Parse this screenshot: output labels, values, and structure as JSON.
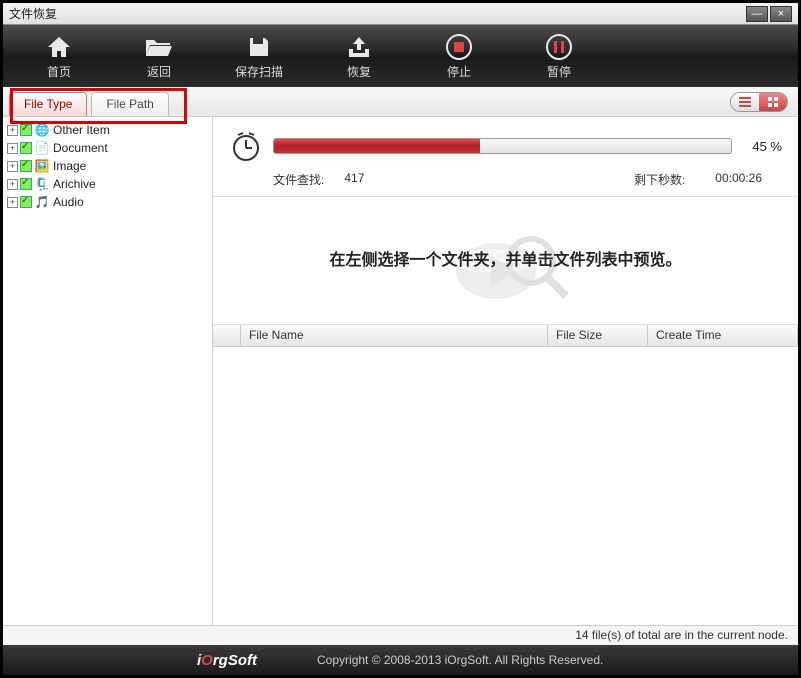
{
  "title": "文件恢复",
  "winbuttons": {
    "min": "—",
    "close": "×"
  },
  "toolbar": [
    {
      "label": "首页",
      "icon": "home"
    },
    {
      "label": "返回",
      "icon": "folder"
    },
    {
      "label": "保存扫描",
      "icon": "save"
    },
    {
      "label": "恢复",
      "icon": "recover"
    },
    {
      "label": "停止",
      "icon": "stop"
    },
    {
      "label": "暂停",
      "icon": "pause"
    }
  ],
  "tabs": {
    "type": "File Type",
    "path": "File Path"
  },
  "tree": [
    {
      "label": "Other Item",
      "icon": "globe"
    },
    {
      "label": "Document",
      "icon": "doc"
    },
    {
      "label": "Image",
      "icon": "img"
    },
    {
      "label": "Arichive",
      "icon": "zip"
    },
    {
      "label": "Audio",
      "icon": "audio"
    }
  ],
  "progress": {
    "percent_label": "45 %",
    "percent_value": 45,
    "scan_label": "文件查找:",
    "scan_value": "417",
    "remain_label": "剩下秒数:",
    "remain_value": "00:00:26"
  },
  "preview_hint": "在左侧选择一个文件夹，并单击文件列表中预览。",
  "columns": {
    "name": "File Name",
    "size": "File Size",
    "time": "Create Time"
  },
  "status": "14 file(s) of total are in the current node.",
  "footer": {
    "brand_i": "i",
    "brand_o": "O",
    "brand_rest": "rgSoft",
    "copyright": "Copyright © 2008-2013 iOrgSoft. All Rights Reserved."
  }
}
